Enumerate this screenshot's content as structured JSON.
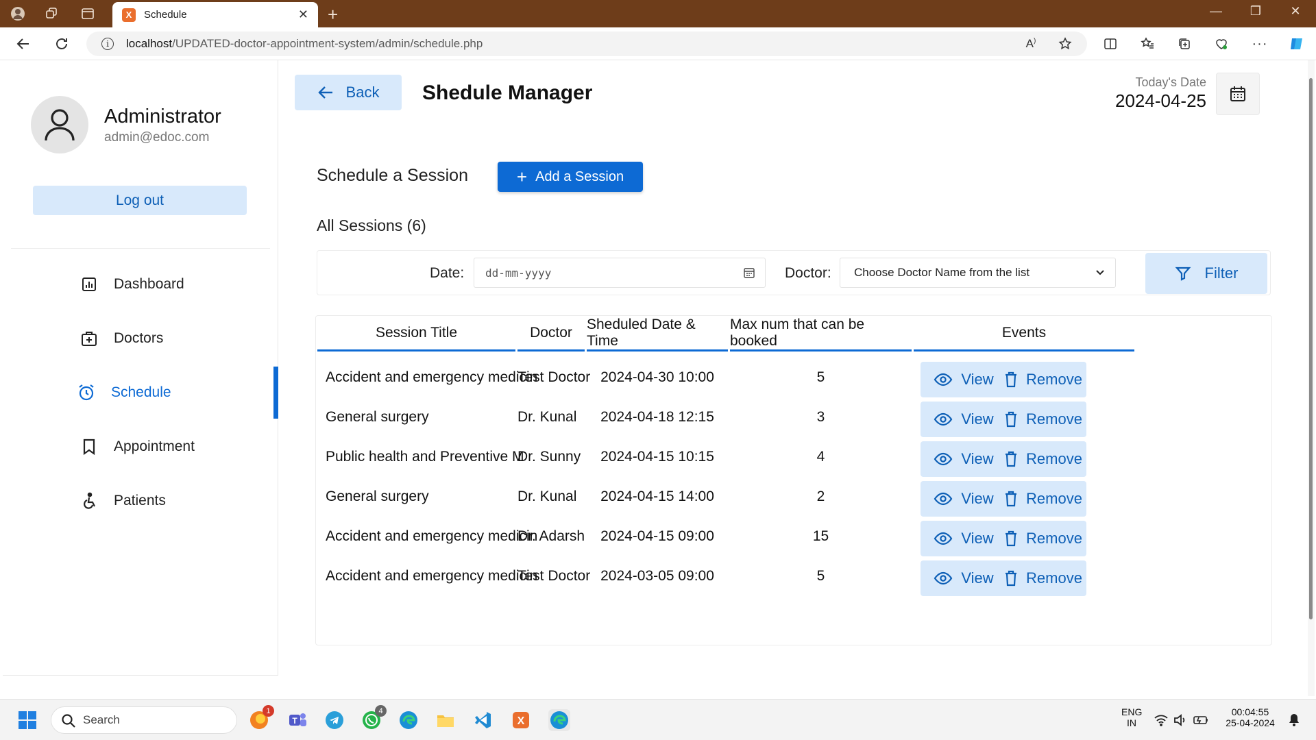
{
  "browser": {
    "tab_title": "Schedule",
    "url_host": "localhost",
    "url_path": "/UPDATED-doctor-appointment-system/admin/schedule.php",
    "favicon_letter": "X"
  },
  "sidebar": {
    "admin_name": "Administrator",
    "admin_email": "admin@edoc.com",
    "logout_label": "Log out",
    "items": [
      {
        "label": "Dashboard",
        "icon": "dashboard-icon"
      },
      {
        "label": "Doctors",
        "icon": "doctors-icon"
      },
      {
        "label": "Schedule",
        "icon": "schedule-icon",
        "active": true
      },
      {
        "label": "Appointment",
        "icon": "bookmark-icon"
      },
      {
        "label": "Patients",
        "icon": "patients-icon"
      }
    ]
  },
  "header": {
    "back_label": "Back",
    "title": "Shedule Manager",
    "today_label": "Today's Date",
    "today_value": "2024-04-25"
  },
  "schedule": {
    "section_title": "Schedule a Session",
    "add_label": "Add a Session",
    "all_sessions": "All Sessions (6)"
  },
  "filter": {
    "date_label": "Date:",
    "date_placeholder": "dd-mm-yyyy",
    "doctor_label": "Doctor:",
    "doctor_selected": "Choose Doctor Name from the list",
    "filter_label": "Filter"
  },
  "table": {
    "headers": [
      "Session Title",
      "Doctor",
      "Sheduled Date & Time",
      "Max num that can be booked",
      "Events"
    ],
    "view_label": "View",
    "remove_label": "Remove",
    "rows": [
      {
        "title": "Accident and emergency medicin",
        "doctor": "Test Doctor",
        "datetime": "2024-04-30 10:00",
        "max": "5"
      },
      {
        "title": "General surgery",
        "doctor": "Dr. Kunal",
        "datetime": "2024-04-18 12:15",
        "max": "3"
      },
      {
        "title": "Public health and Preventive M",
        "doctor": "Dr. Sunny",
        "datetime": "2024-04-15 10:15",
        "max": "4"
      },
      {
        "title": "General surgery",
        "doctor": "Dr. Kunal",
        "datetime": "2024-04-15 14:00",
        "max": "2"
      },
      {
        "title": "Accident and emergency medicin",
        "doctor": "Dr. Adarsh",
        "datetime": "2024-04-15 09:00",
        "max": "15"
      },
      {
        "title": "Accident and emergency medicin",
        "doctor": "Test Doctor",
        "datetime": "2024-03-05 09:00",
        "max": "5"
      }
    ]
  },
  "taskbar": {
    "search_label": "Search",
    "lang_top": "ENG",
    "lang_bottom": "IN",
    "time": "00:04:55",
    "date": "25-04-2024",
    "badge_firefox": "1",
    "badge_whatsapp": "4"
  },
  "colors": {
    "accent": "#0d6ad4",
    "accent_soft": "#d8e9fb",
    "tabbar": "#6e3d1a"
  }
}
